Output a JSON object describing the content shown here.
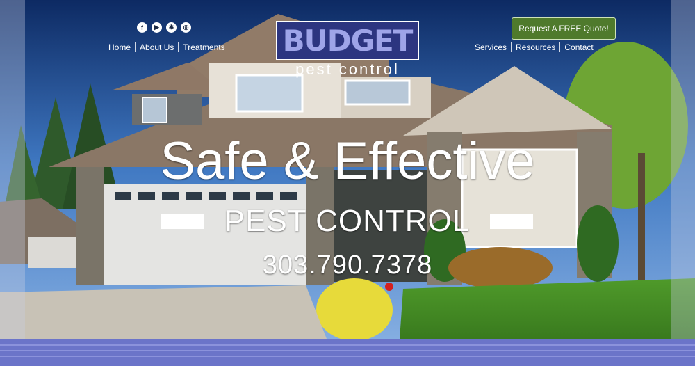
{
  "social": {
    "icons": [
      {
        "name": "facebook-icon",
        "glyph": "f"
      },
      {
        "name": "youtube-icon",
        "glyph": "▶"
      },
      {
        "name": "yelp-icon",
        "glyph": "✱"
      },
      {
        "name": "target-icon",
        "glyph": "◎"
      }
    ]
  },
  "nav_left": [
    "Home",
    "About Us",
    "Treatments"
  ],
  "nav_right": [
    "Services",
    "Resources",
    "Contact"
  ],
  "logo": {
    "main": "BUDGET",
    "sub": "pest control"
  },
  "quote_button": "Request A FREE Quote!",
  "hero": {
    "headline": "Safe & Effective",
    "subline": "PEST CONTROL",
    "phone": "303.790.7378"
  },
  "colors": {
    "brand_navy": "#2c3580",
    "logo_text": "#9ea4e8",
    "cta_green": "#4f7a2c",
    "bottom_band": "#6b74c9"
  }
}
